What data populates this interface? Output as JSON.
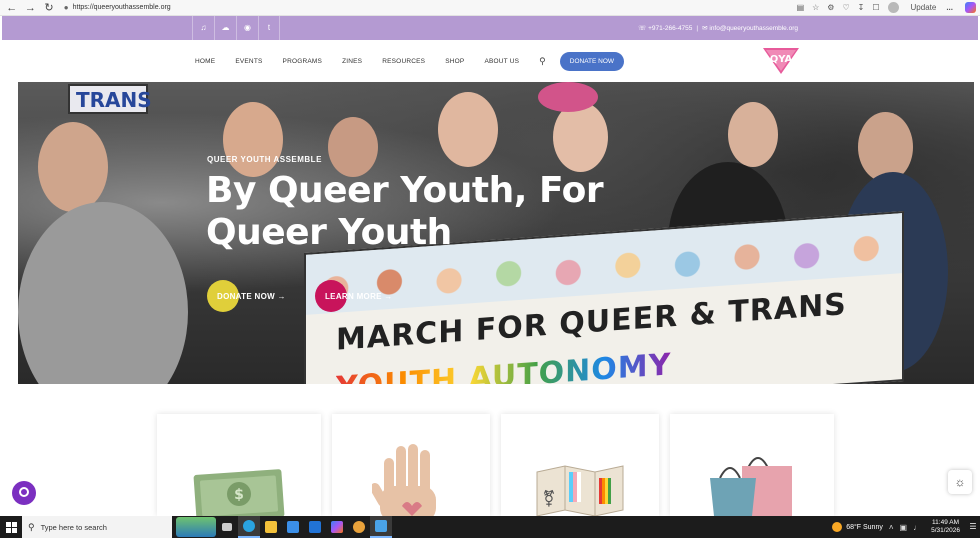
{
  "browser": {
    "url": "https://queeryouthassemble.org",
    "update_label": "Update",
    "more_label": "..."
  },
  "topbar": {
    "social": [
      "tiktok-icon",
      "soundcloud-icon",
      "instagram-icon",
      "tumblr-icon"
    ],
    "phone": "+971-266-4755",
    "email": "info@queeryouthassemble.org"
  },
  "nav": {
    "items": [
      "HOME",
      "EVENTS",
      "PROGRAMS",
      "ZINES",
      "RESOURCES",
      "SHOP",
      "ABOUT US"
    ],
    "donate_label": "DONATE NOW",
    "logo_text": "QYA"
  },
  "hero": {
    "eyebrow": "QUEER YOUTH ASSEMBLE",
    "headline": "By Queer Youth, For Queer Youth",
    "donate_cta": "DONATE NOW →",
    "learn_cta": "LEARN MORE →",
    "sign_text": "TRANS",
    "banner_line1": "MARCH FOR QUEER & TRANS",
    "banner_line2": "YOUTH AUTONOMY"
  },
  "cards": [
    {
      "icon": "money-icon"
    },
    {
      "icon": "raised-hand-icon"
    },
    {
      "icon": "folded-map-icon"
    },
    {
      "icon": "shopping-bags-icon"
    }
  ],
  "taskbar": {
    "search_placeholder": "Type here to search",
    "weather": "68°F  Sunny",
    "time": "11:49 AM",
    "date": "5/31/2026"
  },
  "colors": {
    "topbar": "#b49ad2",
    "donate_button": "#4a73c8",
    "donate_circle": "#e0cf3a",
    "learn_circle": "#c8145b",
    "accent_pink": "#e75a9a"
  }
}
